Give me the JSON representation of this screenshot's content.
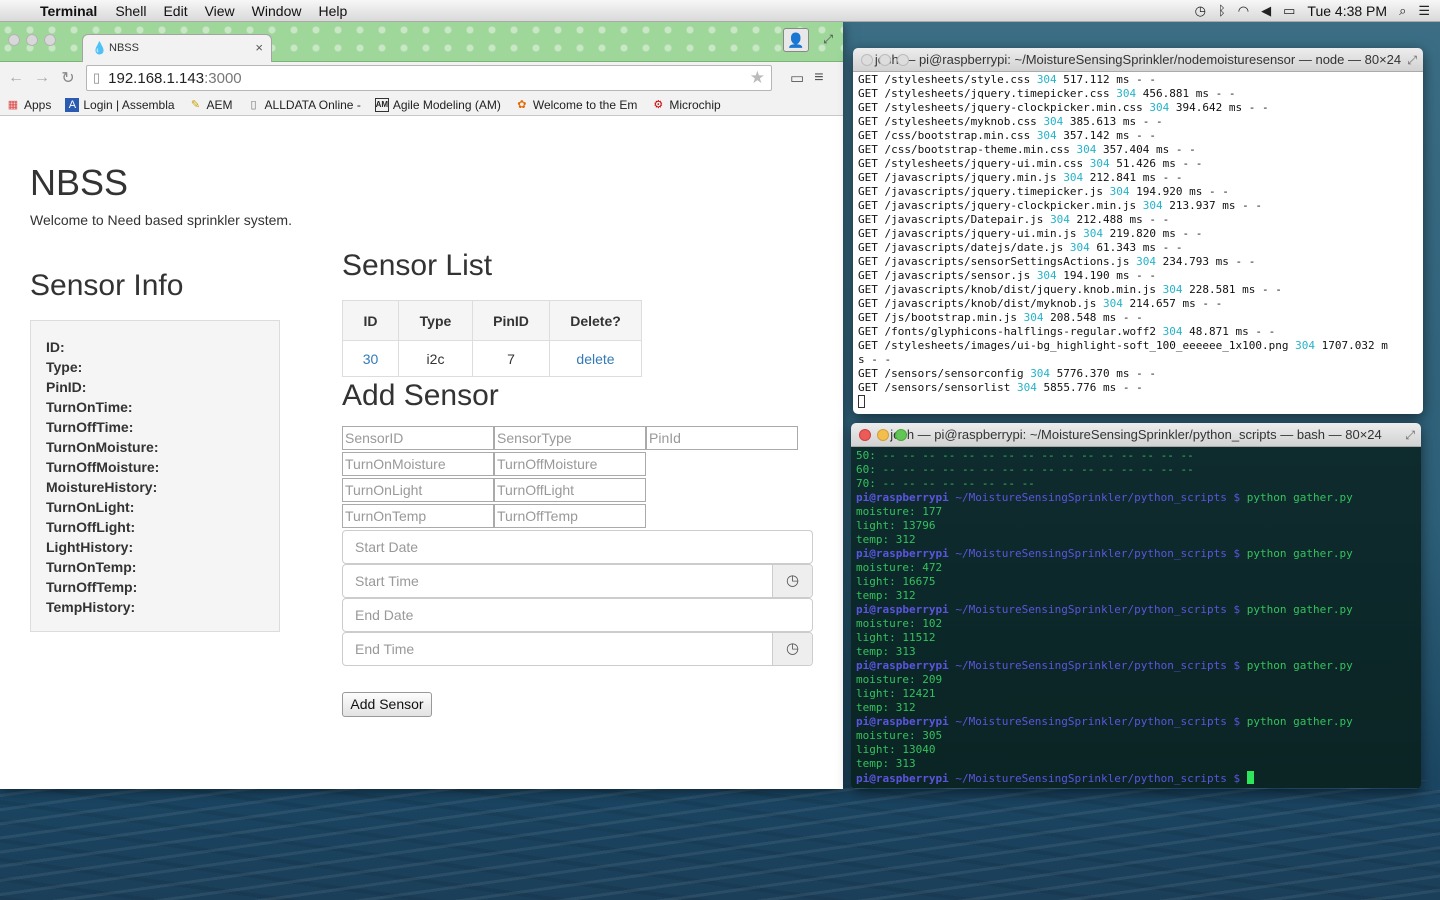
{
  "menubar": {
    "app": "Terminal",
    "items": [
      "Shell",
      "Edit",
      "View",
      "Window",
      "Help"
    ],
    "clock": "Tue 4:38 PM"
  },
  "browser": {
    "tab_title": "NBSS",
    "url_host": "192.168.1.143",
    "url_port": ":3000",
    "bookmarks": [
      "Apps",
      "Login | Assembla",
      "AEM",
      "ALLDATA Online -",
      "Agile Modeling (AM)",
      "Welcome to the Em",
      "Microchip"
    ],
    "page": {
      "title": "NBSS",
      "welcome": "Welcome to Need based sprinkler system.",
      "sensor_info": {
        "heading": "Sensor Info",
        "fields": [
          "ID:",
          "Type:",
          "PinID:",
          "TurnOnTime:",
          "TurnOffTime:",
          "TurnOnMoisture:",
          "TurnOffMoisture:",
          "MoistureHistory:",
          "TurnOnLight:",
          "TurnOffLight:",
          "LightHistory:",
          "TurnOnTemp:",
          "TurnOffTemp:",
          "TempHistory:"
        ]
      },
      "sensor_list": {
        "heading": "Sensor List",
        "columns": [
          "ID",
          "Type",
          "PinID",
          "Delete?"
        ],
        "rows": [
          {
            "id": "30",
            "type": "i2c",
            "pin": "7",
            "delete": "delete"
          }
        ]
      },
      "add_sensor": {
        "heading": "Add Sensor",
        "placeholders": {
          "sensor_id": "SensorID",
          "sensor_type": "SensorType",
          "pin_id": "PinId",
          "on_moist": "TurnOnMoisture",
          "off_moist": "TurnOffMoisture",
          "on_light": "TurnOnLight",
          "off_light": "TurnOffLight",
          "on_temp": "TurnOnTemp",
          "off_temp": "TurnOffTemp",
          "start_date": "Start Date",
          "start_time": "Start Time",
          "end_date": "End Date",
          "end_time": "End Time"
        },
        "button": "Add Sensor"
      }
    }
  },
  "term1": {
    "title": "josh — pi@raspberrypi: ~/MoistureSensingSprinkler/nodemoisturesensor — node — 80×24",
    "lines": [
      {
        "p": "GET /stylesheets/style.css ",
        "s": "304",
        "t": " 517.112 ms - -"
      },
      {
        "p": "GET /stylesheets/jquery.timepicker.css ",
        "s": "304",
        "t": " 456.881 ms - -"
      },
      {
        "p": "GET /stylesheets/jquery-clockpicker.min.css ",
        "s": "304",
        "t": " 394.642 ms - -"
      },
      {
        "p": "GET /stylesheets/myknob.css ",
        "s": "304",
        "t": " 385.613 ms - -"
      },
      {
        "p": "GET /css/bootstrap.min.css ",
        "s": "304",
        "t": " 357.142 ms - -"
      },
      {
        "p": "GET /css/bootstrap-theme.min.css ",
        "s": "304",
        "t": " 357.404 ms - -"
      },
      {
        "p": "GET /stylesheets/jquery-ui.min.css ",
        "s": "304",
        "t": " 51.426 ms - -"
      },
      {
        "p": "GET /javascripts/jquery.min.js ",
        "s": "304",
        "t": " 212.841 ms - -"
      },
      {
        "p": "GET /javascripts/jquery.timepicker.js ",
        "s": "304",
        "t": " 194.920 ms - -"
      },
      {
        "p": "GET /javascripts/jquery-clockpicker.min.js ",
        "s": "304",
        "t": " 213.937 ms - -"
      },
      {
        "p": "GET /javascripts/Datepair.js ",
        "s": "304",
        "t": " 212.488 ms - -"
      },
      {
        "p": "GET /javascripts/jquery-ui.min.js ",
        "s": "304",
        "t": " 219.820 ms - -"
      },
      {
        "p": "GET /javascripts/datejs/date.js ",
        "s": "304",
        "t": " 61.343 ms - -"
      },
      {
        "p": "GET /javascripts/sensorSettingsActions.js ",
        "s": "304",
        "t": " 234.793 ms - -"
      },
      {
        "p": "GET /javascripts/sensor.js ",
        "s": "304",
        "t": " 194.190 ms - -"
      },
      {
        "p": "GET /javascripts/knob/dist/jquery.knob.min.js ",
        "s": "304",
        "t": " 228.581 ms - -"
      },
      {
        "p": "GET /javascripts/knob/dist/myknob.js ",
        "s": "304",
        "t": " 214.657 ms - -"
      },
      {
        "p": "GET /js/bootstrap.min.js ",
        "s": "304",
        "t": " 208.548 ms - -"
      },
      {
        "p": "GET /fonts/glyphicons-halflings-regular.woff2 ",
        "s": "304",
        "t": " 48.871 ms - -"
      },
      {
        "p": "GET /stylesheets/images/ui-bg_highlight-soft_100_eeeeee_1x100.png ",
        "s": "304",
        "t": " 1707.032 m"
      },
      {
        "p": "s - -",
        "s": "",
        "t": ""
      },
      {
        "p": "GET /sensors/sensorconfig ",
        "s": "304",
        "t": " 5776.370 ms - -"
      },
      {
        "p": "GET /sensors/sensorlist ",
        "s": "304",
        "t": " 5855.776 ms - -"
      }
    ]
  },
  "term2": {
    "title": "josh — pi@raspberrypi: ~/MoistureSensingSprinkler/python_scripts — bash — 80×24",
    "scan_lines": [
      "50: -- -- -- -- -- -- -- -- -- -- -- -- -- -- -- --",
      "60: -- -- -- -- -- -- -- -- -- -- -- -- -- -- -- --",
      "70: -- -- -- -- -- -- -- --"
    ],
    "prompt_user": "pi@raspberrypi",
    "prompt_path": " ~/MoistureSensingSprinkler/python_scripts $",
    "command": " python gather.py",
    "runs": [
      {
        "moisture": "moisture: 177",
        "light": "light: 13796",
        "temp": "temp: 312"
      },
      {
        "moisture": "moisture: 472",
        "light": "light: 16675",
        "temp": "temp: 312"
      },
      {
        "moisture": "moisture: 102",
        "light": "light: 11512",
        "temp": "temp: 313"
      },
      {
        "moisture": "moisture: 209",
        "light": "light: 12421",
        "temp": "temp: 312"
      },
      {
        "moisture": "moisture: 305",
        "light": "light: 13040",
        "temp": "temp: 313"
      }
    ]
  },
  "icons": [
    "apple-icon",
    "cast-icon",
    "menu-icon",
    "clock-icon",
    "star-icon",
    "wifi-icon",
    "volume-icon",
    "battery-icon",
    "search-icon",
    "list-icon"
  ]
}
